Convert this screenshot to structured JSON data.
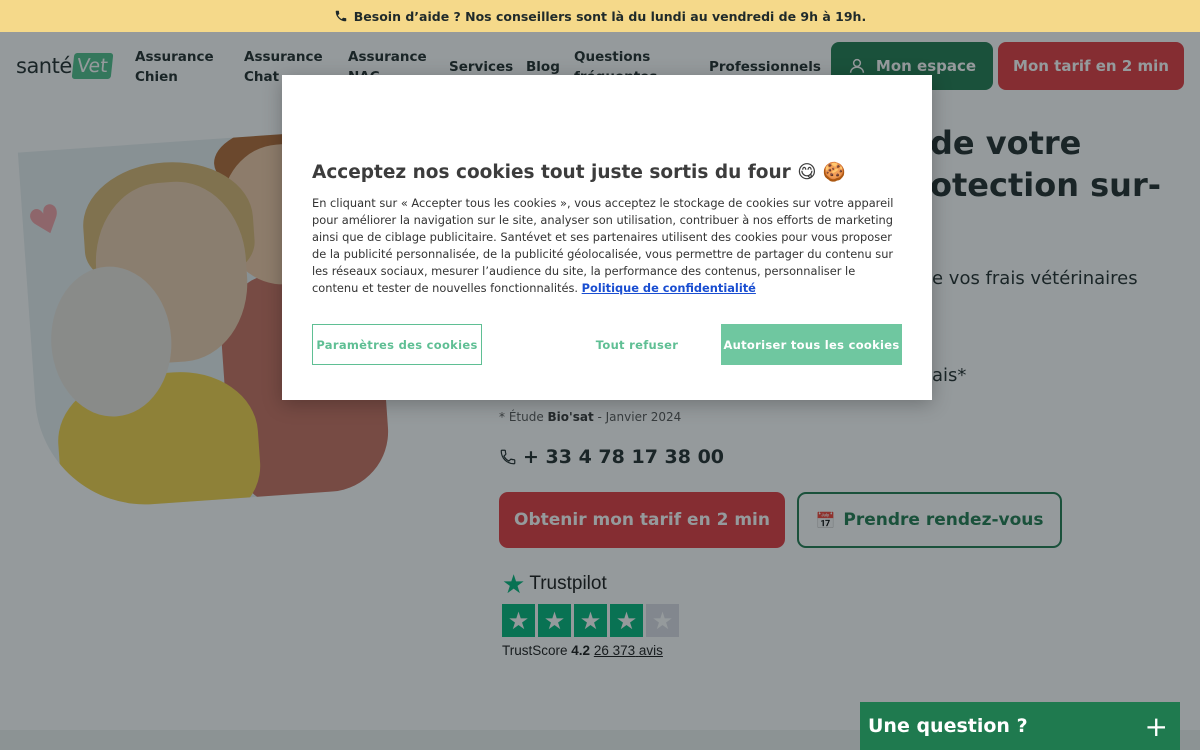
{
  "topbar": {
    "text": "Besoin d’aide ? Nos conseillers sont là du lundi au vendredi de 9h à 19h."
  },
  "header": {
    "logo_text": "santé",
    "logo_badge": "Vet",
    "nav": [
      {
        "label": "Assurance Chien"
      },
      {
        "label": "Assurance Chat"
      },
      {
        "label": "Assurance NAC"
      },
      {
        "label": "Services"
      },
      {
        "label": "Blog"
      },
      {
        "label": "Questions fréquentes"
      },
      {
        "label": "Professionnels"
      }
    ],
    "espace_label": "Mon espace",
    "tarif_label": "Mon tarif en 2 min"
  },
  "hero": {
    "title": "de votre otection sur-",
    "subtitle": "e vos frais vétérinaires",
    "ais": "ais*",
    "study_prefix": "* Étude ",
    "study_brand": "Bio'sat",
    "study_suffix": " - Janvier 2024",
    "phone": "+ 33 4 78 17 38 00",
    "cta_quote": "Obtenir mon tarif en 2 min",
    "cta_appointment": "Prendre rendez-vous"
  },
  "trustpilot": {
    "brand": "Trustpilot",
    "score_label": "TrustScore",
    "score": "4.2",
    "reviews_count": "26 373",
    "reviews_label": "avis",
    "stars_filled": 4,
    "stars_total": 5
  },
  "cookie_modal": {
    "title": "Acceptez nos cookies tout juste sortis du four 😋 🍪",
    "body": "En cliquant sur « Accepter tous les cookies », vous acceptez le stockage de cookies sur votre appareil pour améliorer la navigation sur le site, analyser son utilisation, contribuer à nos efforts de marketing ainsi que de ciblage publicitaire. Santévet et ses partenaires utilisent des cookies pour vous proposer de la publicité personnalisée, de la publicité géolocalisée, vous permettre de partager du contenu sur les réseaux sociaux, mesurer l’audience du site, la performance des contenus, personnaliser le contenu et tester de nouvelles fonctionnalités.",
    "privacy_link": "Politique de confidentialité",
    "settings_label": "Paramètres des cookies",
    "refuse_label": "Tout refuser",
    "accept_label": "Autoriser tous les cookies"
  },
  "chat": {
    "label": "Une question ?",
    "plus": "+"
  },
  "colors": {
    "topbar_bg": "#f5d98a",
    "brand_green": "#1f7a4f",
    "brand_red": "#e23a3f",
    "cookie_green": "#6fc7a0",
    "trustpilot_green": "#00b67a"
  }
}
